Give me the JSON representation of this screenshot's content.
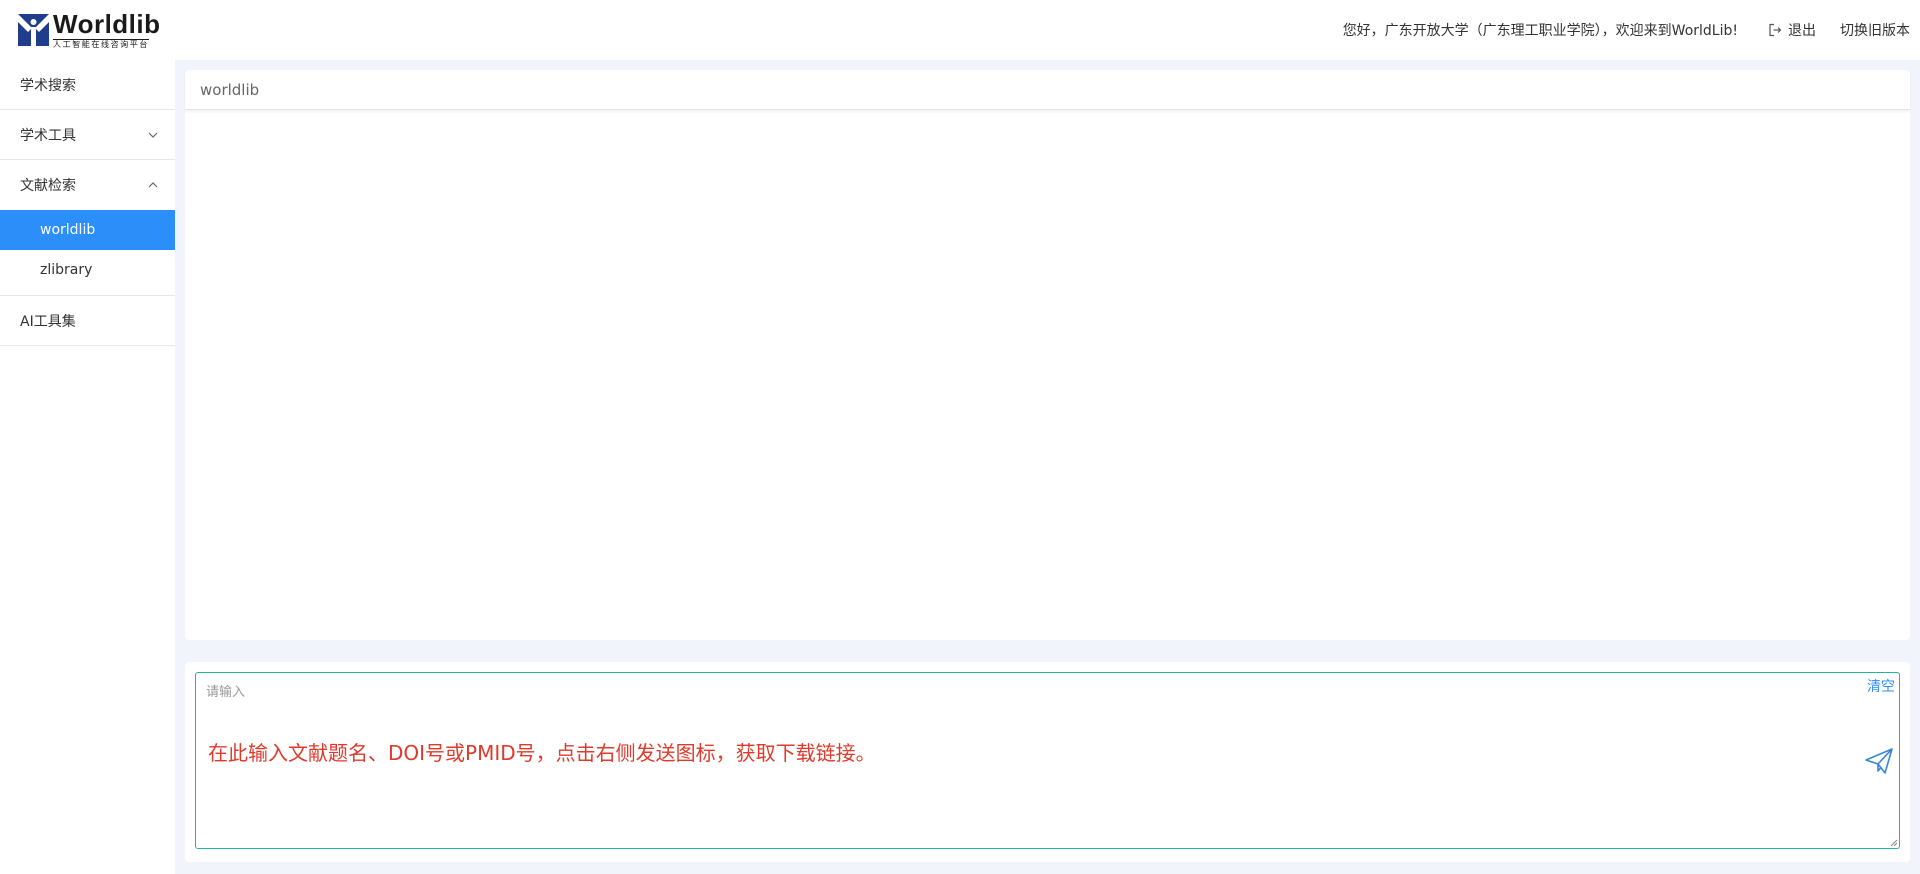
{
  "brand": {
    "name": "Worldlib",
    "tagline": "人工智能在线咨询平台",
    "color": "#1f3d8a"
  },
  "header": {
    "greeting": "您好，广东开放大学（广东理工职业学院），欢迎来到WorldLib!",
    "logout_label": "退出",
    "logout_icon": "logout-icon",
    "switch_label": "切换旧版本"
  },
  "sidebar": {
    "items": [
      {
        "label": "学术搜索"
      },
      {
        "label": "学术工具",
        "icon": "chevron-down-icon"
      },
      {
        "label": "文献检索",
        "icon": "chevron-up-icon",
        "children": [
          {
            "label": "worldlib",
            "active": true
          },
          {
            "label": "zlibrary"
          }
        ]
      },
      {
        "label": "AI工具集"
      }
    ],
    "active_color": "#2b8ef9"
  },
  "main": {
    "panel_title": "worldlib",
    "input": {
      "placeholder": "请输入",
      "value": "",
      "clear_label": "清空",
      "send_icon": "send-icon",
      "hint": "在此输入文献题名、DOI号或PMID号，点击右侧发送图标，获取下载链接。",
      "border_color": "#1fb79a",
      "hint_color": "#e03a2c"
    }
  }
}
